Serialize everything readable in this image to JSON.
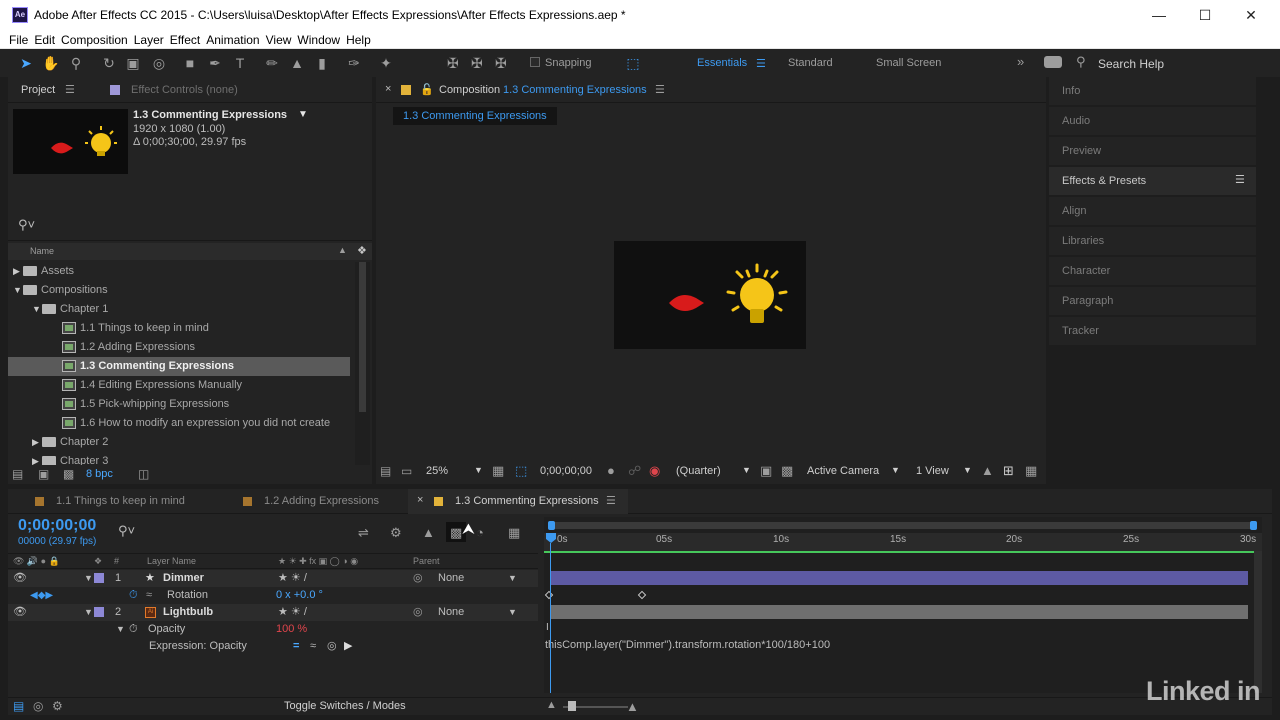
{
  "app": {
    "title": "Adobe After Effects CC 2015 - C:\\Users\\luisa\\Desktop\\After Effects Expressions\\After Effects Expressions.aep *",
    "logo_text": "Ae"
  },
  "menu": [
    "File",
    "Edit",
    "Composition",
    "Layer",
    "Effect",
    "Animation",
    "View",
    "Window",
    "Help"
  ],
  "toolbar": {
    "snapping_label": "Snapping",
    "workspaces": [
      "Essentials",
      "Standard",
      "Small Screen"
    ],
    "active_workspace": "Essentials",
    "search_placeholder": "Search Help"
  },
  "project_panel": {
    "tab_project": "Project",
    "tab_effect_controls": "Effect Controls (none)",
    "selected_comp": {
      "name": "1.3  Commenting Expressions",
      "resolution": "1920 x 1080 (1.00)",
      "duration": "Δ 0;00;30;00, 29.97 fps"
    },
    "column_name": "Name",
    "tree": [
      {
        "label": "Assets",
        "type": "folder",
        "level": 0,
        "expanded": false
      },
      {
        "label": "Compositions",
        "type": "folder",
        "level": 0,
        "expanded": true
      },
      {
        "label": "Chapter 1",
        "type": "folder",
        "level": 1,
        "expanded": true
      },
      {
        "label": "1.1 Things to keep in mind",
        "type": "comp",
        "level": 2
      },
      {
        "label": "1.2  Adding Expressions",
        "type": "comp",
        "level": 2
      },
      {
        "label": "1.3  Commenting Expressions",
        "type": "comp",
        "level": 2,
        "selected": true
      },
      {
        "label": "1.4  Editing Expressions Manually",
        "type": "comp",
        "level": 2
      },
      {
        "label": "1.5  Pick-whipping Expressions",
        "type": "comp",
        "level": 2
      },
      {
        "label": "1.6  How to modify an expression you did not create",
        "type": "comp",
        "level": 2
      },
      {
        "label": "Chapter 2",
        "type": "folder",
        "level": 1,
        "expanded": false
      },
      {
        "label": "Chapter 3",
        "type": "folder",
        "level": 1,
        "expanded": false
      }
    ],
    "bpc": "8 bpc"
  },
  "comp_panel": {
    "tab_label": "Composition",
    "tab_comp_name": "1.3  Commenting Expressions",
    "breadcrumb": "1.3  Commenting Expressions",
    "zoom": "25%",
    "timecode": "0;00;00;00",
    "resolution": "(Quarter)",
    "camera": "Active Camera",
    "views": "1 View"
  },
  "right_panels": [
    "Info",
    "Audio",
    "Preview",
    "Effects & Presets",
    "Align",
    "Libraries",
    "Character",
    "Paragraph",
    "Tracker"
  ],
  "timeline": {
    "tabs": [
      "1.1 Things to keep in mind",
      "1.2  Adding Expressions",
      "1.3  Commenting Expressions"
    ],
    "current_time": "0;00;00;00",
    "frame_info": "00000 (29.97 fps)",
    "col_number": "#",
    "col_layer_name": "Layer Name",
    "col_parent": "Parent",
    "ruler_labels": [
      "0s",
      "05s",
      "10s",
      "15s",
      "20s",
      "25s",
      "30s"
    ],
    "layers": [
      {
        "num": "1",
        "name": "Dimmer",
        "parent": "None",
        "color": "#8d88d6"
      },
      {
        "num": "2",
        "name": "Lightbulb",
        "parent": "None",
        "color": "#8d88d6"
      }
    ],
    "rotation_label": "Rotation",
    "rotation_value": "0 x +0.0 °",
    "opacity_label": "Opacity",
    "opacity_value": "100 %",
    "expression_label": "Expression: Opacity",
    "expression_text": "thisComp.layer(\"Dimmer\").transform.rotation*100/180+100",
    "toggle_label": "Toggle Switches / Modes"
  },
  "watermark": "Linked in",
  "colors": {
    "accent": "#3d9af0",
    "selection": "#5a5a5a",
    "layer_purple": "#5d5aa3",
    "layer_gray": "#6f6f6f",
    "work_area": "#46c75b",
    "opacity_red": "#e0454c"
  }
}
